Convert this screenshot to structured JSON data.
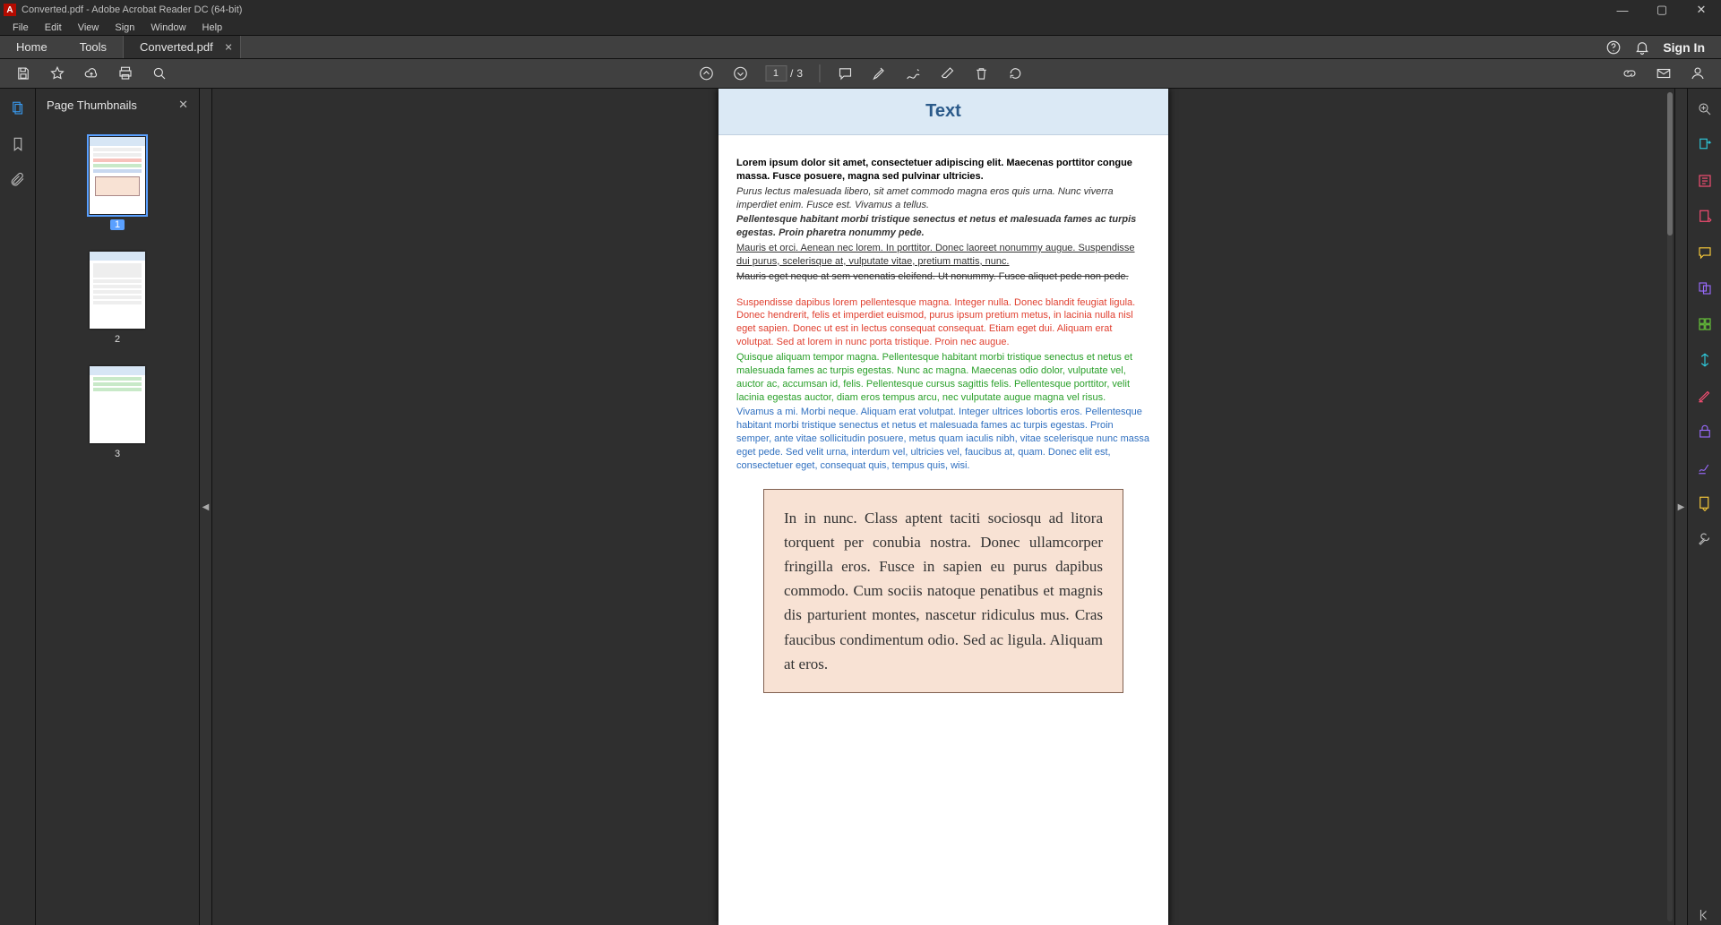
{
  "title": "Converted.pdf - Adobe Acrobat Reader DC (64-bit)",
  "menu": [
    "File",
    "Edit",
    "View",
    "Sign",
    "Window",
    "Help"
  ],
  "tabs": {
    "home": "Home",
    "tools": "Tools",
    "doc": "Converted.pdf"
  },
  "topright": {
    "signin": "Sign In"
  },
  "page": {
    "current": "1",
    "sep": "/",
    "total": "3"
  },
  "thumbs": {
    "title": "Page Thumbnails",
    "items": [
      {
        "n": "1",
        "sel": true
      },
      {
        "n": "2",
        "sel": false
      },
      {
        "n": "3",
        "sel": false
      }
    ]
  },
  "doc": {
    "heading": "Text",
    "p1": "Lorem ipsum dolor sit amet, consectetuer adipiscing elit. Maecenas porttitor congue massa. Fusce posuere, magna sed pulvinar ultricies.",
    "p2": "Purus lectus malesuada libero, sit amet commodo magna eros quis urna. Nunc viverra imperdiet enim. Fusce est. Vivamus a tellus.",
    "p3": "Pellentesque habitant morbi tristique senectus et netus et malesuada fames ac turpis egestas. Proin pharetra nonummy pede.",
    "p4": "Mauris et orci. Aenean nec lorem. In porttitor. Donec laoreet nonummy augue. Suspendisse dui purus, scelerisque at, vulputate vitae, pretium mattis, nunc.",
    "p5": "Mauris eget neque at sem venenatis eleifend. Ut nonummy. Fusce aliquet pede non pede.",
    "p6": "Suspendisse dapibus lorem pellentesque magna. Integer nulla. Donec blandit feugiat ligula. Donec hendrerit, felis et imperdiet euismod, purus ipsum pretium metus, in lacinia nulla nisl eget sapien. Donec ut est in lectus consequat consequat. Etiam eget dui. Aliquam erat volutpat. Sed at lorem in nunc porta tristique. Proin nec augue.",
    "p7": "Quisque aliquam tempor magna. Pellentesque habitant morbi tristique senectus et netus et malesuada fames ac turpis egestas. Nunc ac magna. Maecenas odio dolor, vulputate vel, auctor ac, accumsan id, felis. Pellentesque cursus sagittis felis. Pellentesque porttitor, velit lacinia egestas auctor, diam eros tempus arcu, nec vulputate augue magna vel risus.",
    "p8": "Vivamus a mi. Morbi neque. Aliquam erat volutpat. Integer ultrices lobortis eros. Pellentesque habitant morbi tristique senectus et netus et malesuada fames ac turpis egestas. Proin semper, ante vitae sollicitudin posuere, metus quam iaculis nibh, vitae scelerisque nunc massa eget pede. Sed velit urna, interdum vel, ultricies vel, faucibus at, quam. Donec elit est, consectetuer eget, consequat quis, tempus quis, wisi.",
    "pbox": "In in nunc. Class aptent taciti sociosqu ad litora torquent per conubia nostra. Donec ullamcorper fringilla eros. Fusce in sapien eu purus dapibus commodo. Cum sociis natoque penatibus et magnis dis parturient montes, nascetur ridiculus mus. Cras faucibus condimentum odio. Sed ac ligula. Aliquam at eros."
  }
}
